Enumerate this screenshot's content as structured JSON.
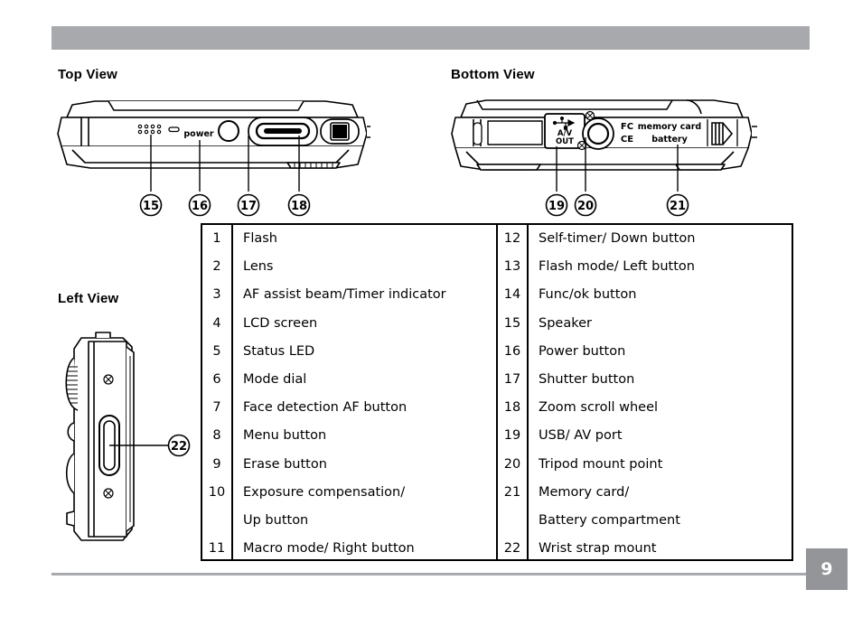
{
  "document": {
    "page_number": "9"
  },
  "views": {
    "top": {
      "heading": "Top View"
    },
    "bottom": {
      "heading": "Bottom View"
    },
    "left": {
      "heading": "Left View"
    }
  },
  "diagram_labels": {
    "power": "power",
    "av_line1": "A/V",
    "av_line2": "OUT",
    "memory_card": "memory  card",
    "battery": "battery",
    "fcc_mark": "FC",
    "ce_mark": "CE"
  },
  "callouts": {
    "top": [
      "15",
      "16",
      "17",
      "18"
    ],
    "bottom": [
      "19",
      "20",
      "21"
    ],
    "left": [
      "22"
    ]
  },
  "parts_table": {
    "left_column": [
      {
        "num": "1",
        "label": "Flash"
      },
      {
        "num": "2",
        "label": "Lens"
      },
      {
        "num": "3",
        "label": "AF assist beam/Timer indicator"
      },
      {
        "num": "4",
        "label": "LCD screen"
      },
      {
        "num": "5",
        "label": "Status LED"
      },
      {
        "num": "6",
        "label": "Mode dial"
      },
      {
        "num": "7",
        "label": "Face detection AF button"
      },
      {
        "num": "8",
        "label": "Menu button"
      },
      {
        "num": "9",
        "label": "Erase button"
      },
      {
        "num": "10",
        "label": "Exposure compensation/"
      },
      {
        "num": "",
        "label": "Up button"
      },
      {
        "num": "11",
        "label": "Macro mode/ Right button"
      }
    ],
    "right_column": [
      {
        "num": "12",
        "label": "Self-timer/ Down button"
      },
      {
        "num": "13",
        "label": "Flash mode/ Left button"
      },
      {
        "num": "14",
        "label": "Func/ok button"
      },
      {
        "num": "15",
        "label": "Speaker"
      },
      {
        "num": "16",
        "label": "Power button"
      },
      {
        "num": "17",
        "label": "Shutter button"
      },
      {
        "num": "18",
        "label": "Zoom scroll wheel"
      },
      {
        "num": "19",
        "label": "USB/ AV port"
      },
      {
        "num": "20",
        "label": "Tripod mount point"
      },
      {
        "num": "21",
        "label": "Memory card/"
      },
      {
        "num": "",
        "label": "Battery compartment"
      },
      {
        "num": "22",
        "label": "Wrist strap mount"
      }
    ]
  },
  "colors": {
    "header_bar": "#a7a9ac",
    "footer_rule": "#a7a9ac",
    "page_badge": "#939598",
    "ink": "#000000"
  }
}
